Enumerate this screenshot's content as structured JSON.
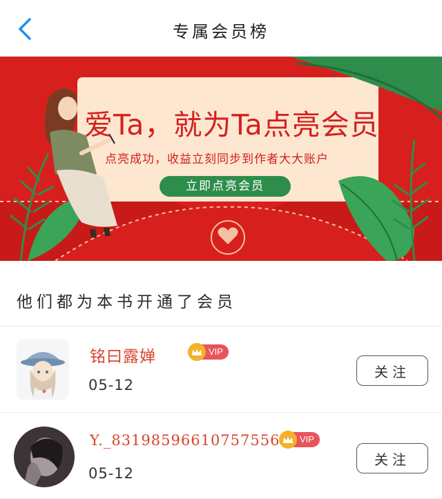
{
  "header": {
    "title": "专属会员榜",
    "back_icon": "chevron-left-icon"
  },
  "banner": {
    "headline": "爱Ta，就为Ta点亮会员",
    "subtitle": "点亮成功，收益立刻同步到作者大大账户",
    "cta_label": "立即点亮会员",
    "colors": {
      "background": "#d7201d",
      "card": "#fde7d0",
      "button": "#2f8d4c",
      "text": "#d32020"
    }
  },
  "section": {
    "title": "他们都为本书开通了会员"
  },
  "members": [
    {
      "name": "铭曰露婵",
      "badge": "VIP",
      "date": "05-12",
      "follow_label": "关注"
    },
    {
      "name": "Y._831985966107575​56",
      "badge": "VIP",
      "date": "05-12",
      "follow_label": "关注"
    }
  ]
}
